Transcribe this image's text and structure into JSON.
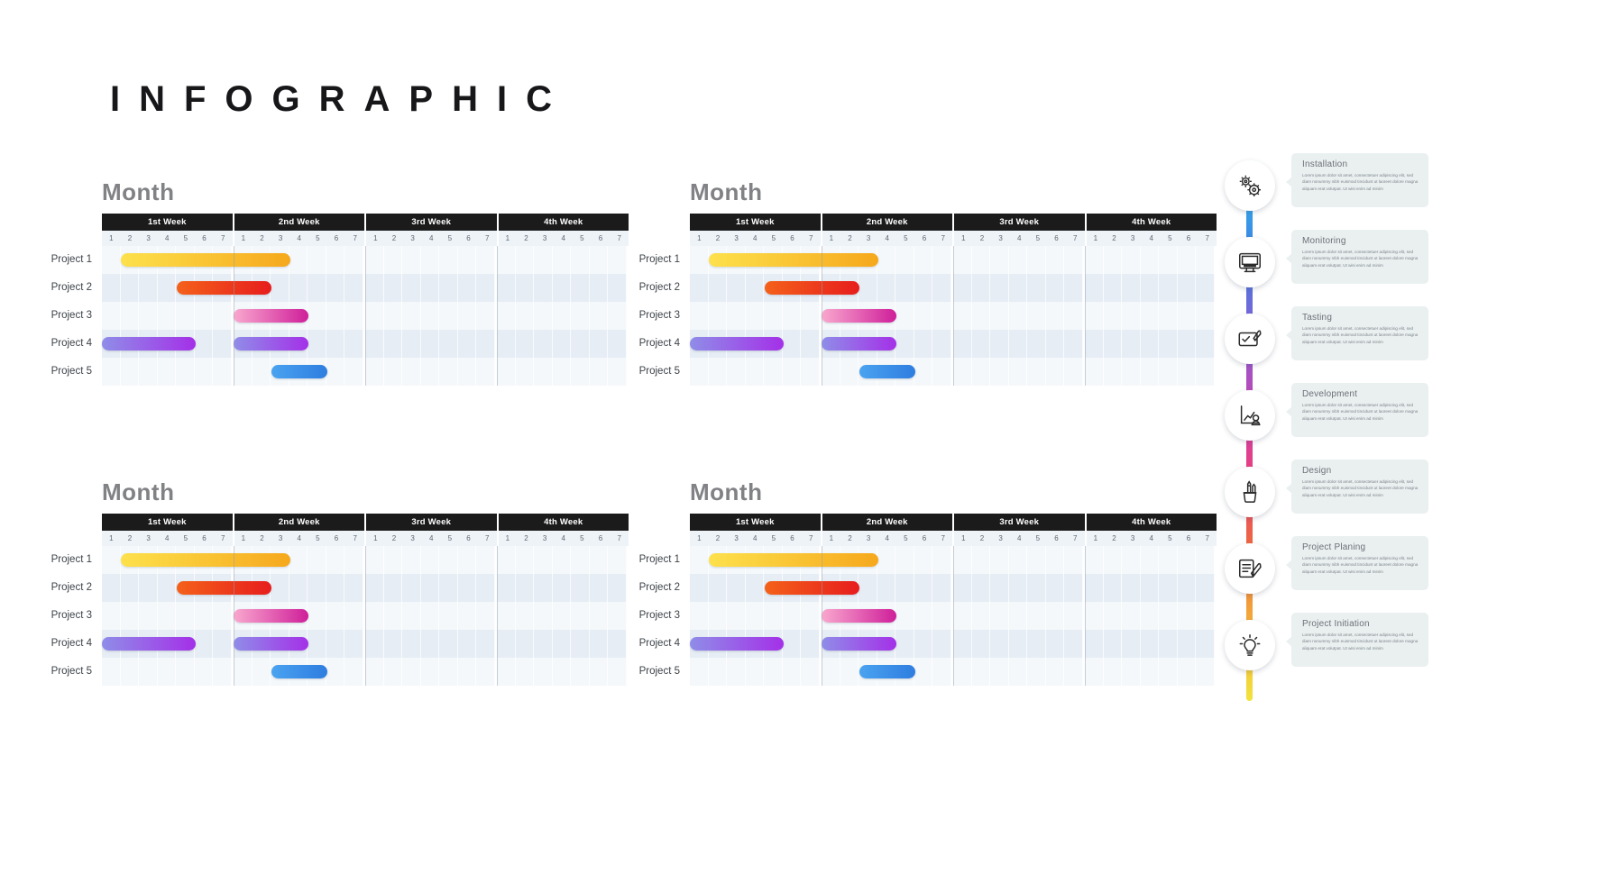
{
  "page": {
    "title": "INFOGRAPHIC",
    "background": "#ffffff"
  },
  "chart_data": {
    "type": "bar",
    "title": "INFOGRAPHIC",
    "chart_style": "gantt",
    "xlabel": "",
    "ylabel": "",
    "weeks": [
      "1st Week",
      "2nd Week",
      "3rd Week",
      "4th Week"
    ],
    "days": [
      "1",
      "2",
      "3",
      "4",
      "5",
      "6",
      "7"
    ],
    "categories": [
      "Project 1",
      "Project 2",
      "Project 3",
      "Project 4",
      "Project 5"
    ],
    "xlim": [
      1,
      28
    ],
    "grid": true,
    "legend": "none",
    "series": [
      {
        "name": "Project 1",
        "color": "#fde14c",
        "color_end": "#f6a81c",
        "bars": [
          {
            "start_day": 2,
            "end_day": 10
          }
        ]
      },
      {
        "name": "Project 2",
        "color": "#f4611a",
        "color_end": "#e71d1d",
        "bars": [
          {
            "start_day": 5,
            "end_day": 9
          }
        ]
      },
      {
        "name": "Project 3",
        "color": "#f9a8ce",
        "color_end": "#cf1f9a",
        "bars": [
          {
            "start_day": 8,
            "end_day": 11
          }
        ]
      },
      {
        "name": "Project 4",
        "color": "#8f8de8",
        "color_end": "#a430e8",
        "bars": [
          {
            "start_day": 1,
            "end_day": 5
          },
          {
            "start_day": 8,
            "end_day": 11
          }
        ]
      },
      {
        "name": "Project 5",
        "color": "#4aa3f0",
        "color_end": "#2e7de0",
        "bars": [
          {
            "start_day": 10,
            "end_day": 12
          }
        ]
      }
    ],
    "panels": [
      {
        "id": "panel-top-left",
        "title": "Month"
      },
      {
        "id": "panel-top-right",
        "title": "Month"
      },
      {
        "id": "panel-bottom-left",
        "title": "Month"
      },
      {
        "id": "panel-bottom-right",
        "title": "Month"
      }
    ]
  },
  "timeline": {
    "spine_colors": [
      "#2ec5f2",
      "#3f7de0",
      "#8b5fd6",
      "#cf3fa8",
      "#e8407e",
      "#ee6a3c",
      "#f3a63b",
      "#f2e33c"
    ],
    "body_text": "Lorem ipsum dolor sit amet, consectetuer adipiscing elit, sed diam nonummy nibh euismod tincidunt ut laoreet dolore magna aliquam erat volutpat. Ut wisi enim ad minim",
    "items": [
      {
        "label": "Installation",
        "icon": "gears-icon",
        "accent": "#2ec5f2"
      },
      {
        "label": "Monitoring",
        "icon": "monitor-icon",
        "accent": "#3f7de0"
      },
      {
        "label": "Tasting",
        "icon": "checklist-icon",
        "accent": "#8b5fd6"
      },
      {
        "label": "Development",
        "icon": "chart-person-icon",
        "accent": "#cf3fa8"
      },
      {
        "label": "Design",
        "icon": "pen-cup-icon",
        "accent": "#e8407e"
      },
      {
        "label": "Project Planing",
        "icon": "notepad-pen-icon",
        "accent": "#f3a63b"
      },
      {
        "label": "Project Initiation",
        "icon": "lightbulb-icon",
        "accent": "#f2e33c"
      }
    ]
  }
}
